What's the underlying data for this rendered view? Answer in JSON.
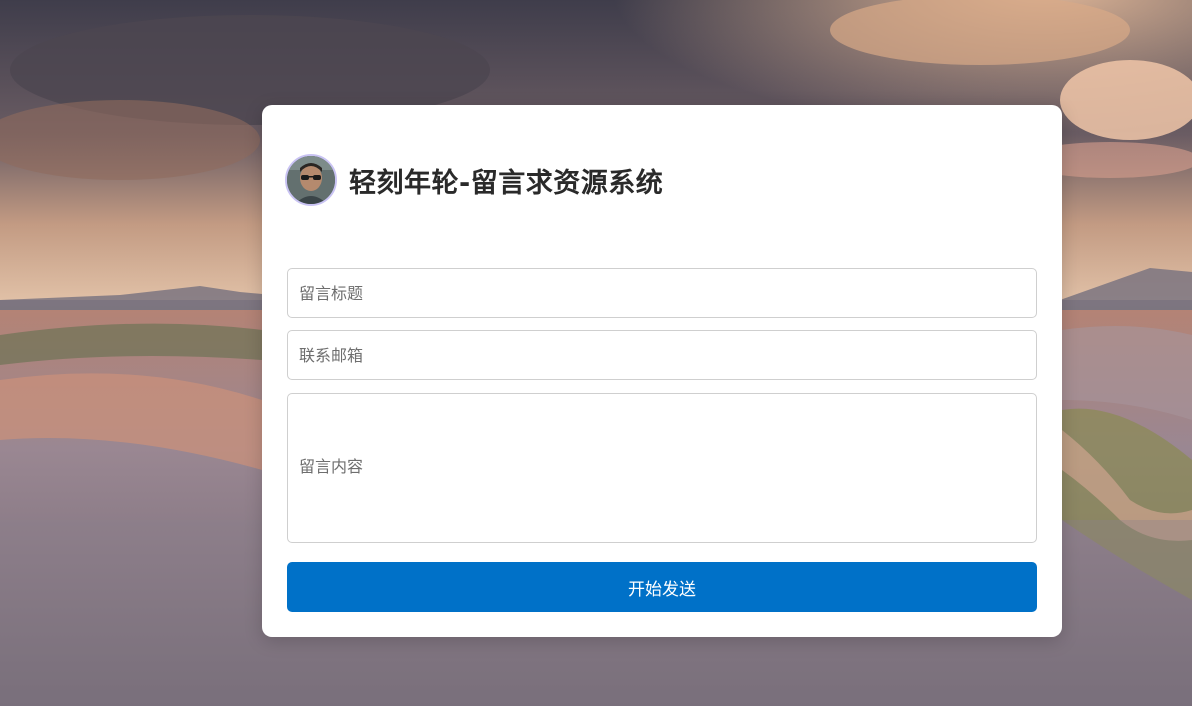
{
  "header": {
    "site_title": "轻刻年轮-留言求资源系统",
    "avatar": "profile-photo"
  },
  "form": {
    "title_placeholder": "留言标题",
    "email_placeholder": "联系邮箱",
    "content_placeholder": "留言内容",
    "submit_label": "开始发送"
  },
  "colors": {
    "card_background": "#ffffff",
    "submit_button": "#0071c8",
    "title_text": "#2a2a2a",
    "avatar_ring": "#c9c3f3"
  }
}
